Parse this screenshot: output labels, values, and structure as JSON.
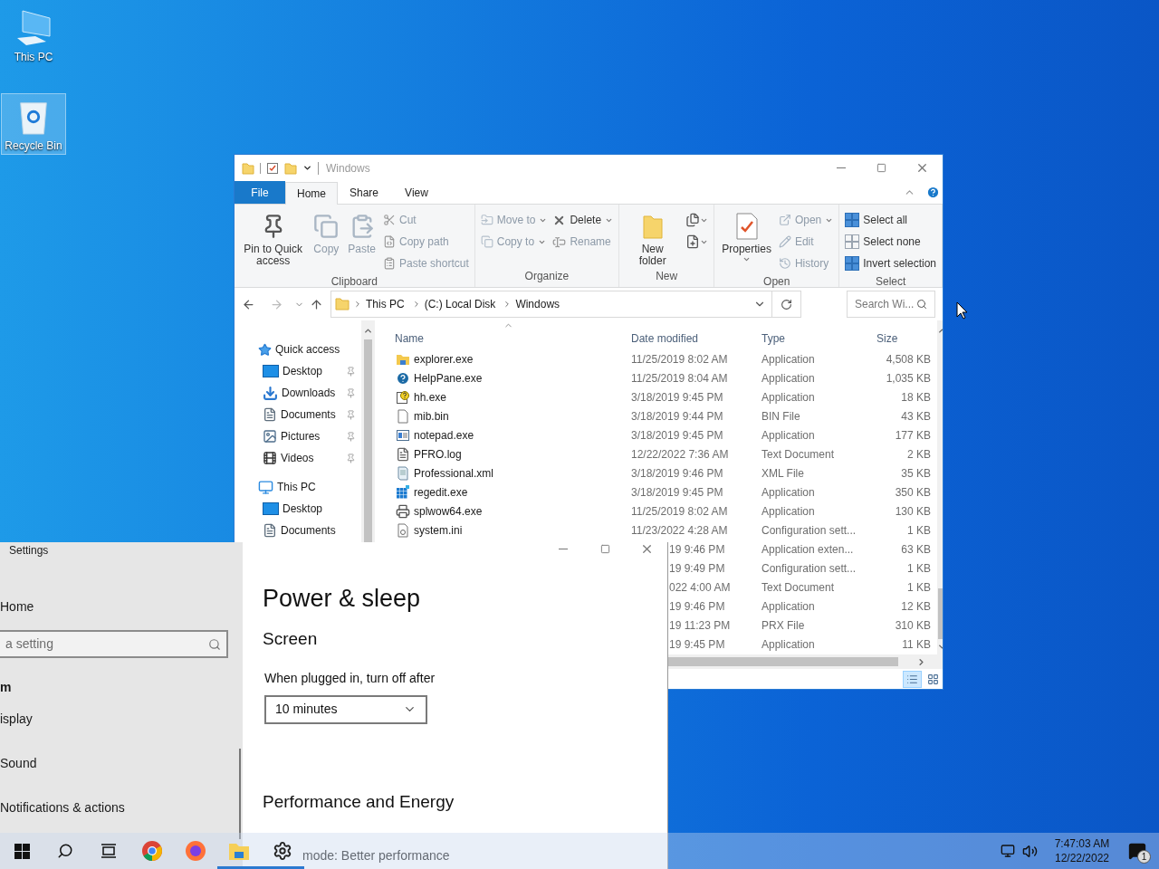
{
  "desktop_icons": [
    {
      "label": "This PC",
      "kind": "computer",
      "selected": false
    },
    {
      "label": "Recycle Bin",
      "kind": "recycle",
      "selected": true
    }
  ],
  "explorer": {
    "title": "Windows",
    "tabs": [
      {
        "label": "File",
        "kind": "file",
        "selected": false
      },
      {
        "label": "Home",
        "kind": "tab",
        "selected": true
      },
      {
        "label": "Share",
        "kind": "tab",
        "selected": false
      },
      {
        "label": "View",
        "kind": "tab",
        "selected": false
      }
    ],
    "ribbon": [
      {
        "label": "Clipboard",
        "columns": [
          [
            {
              "label": "Pin to Quick access",
              "kind": "large",
              "disabled": false,
              "dropdown": false
            }
          ],
          [
            {
              "label": "Copy",
              "kind": "large",
              "disabled": true,
              "dropdown": false
            }
          ],
          [
            {
              "label": "Paste",
              "kind": "large",
              "disabled": true,
              "dropdown": false
            }
          ],
          [
            {
              "label": "Cut",
              "kind": "small",
              "disabled": true,
              "dropdown": false
            },
            {
              "label": "Copy path",
              "kind": "small",
              "disabled": true,
              "dropdown": false
            },
            {
              "label": "Paste shortcut",
              "kind": "small",
              "disabled": true,
              "dropdown": false
            }
          ]
        ]
      },
      {
        "label": "Organize",
        "columns": [
          [
            {
              "label": "Move to",
              "kind": "small",
              "disabled": true,
              "dropdown": true
            },
            {
              "label": "Copy to",
              "kind": "small",
              "disabled": true,
              "dropdown": true
            }
          ],
          [
            {
              "label": "Delete",
              "kind": "small",
              "disabled": false,
              "dropdown": true
            },
            {
              "label": "Rename",
              "kind": "small",
              "disabled": true,
              "dropdown": false
            }
          ]
        ]
      },
      {
        "label": "New",
        "columns": [
          [
            {
              "label": "New folder",
              "kind": "large",
              "disabled": false,
              "dropdown": false
            }
          ],
          [
            {
              "kind": "tool",
              "disabled": false,
              "dropdown": true
            },
            {
              "kind": "tool",
              "disabled": false,
              "dropdown": true
            }
          ]
        ]
      },
      {
        "label": "Open",
        "columns": [
          [
            {
              "label": "Properties",
              "kind": "large",
              "disabled": false,
              "dropdown": true
            }
          ],
          [
            {
              "label": "Open",
              "kind": "small",
              "disabled": true,
              "dropdown": true
            },
            {
              "label": "Edit",
              "kind": "small",
              "disabled": true,
              "dropdown": false
            },
            {
              "label": "History",
              "kind": "small",
              "disabled": true,
              "dropdown": false
            }
          ]
        ]
      },
      {
        "label": "Select",
        "columns": [
          [
            {
              "label": "Select all",
              "kind": "small",
              "disabled": false,
              "dropdown": false
            },
            {
              "label": "Select none",
              "kind": "small",
              "disabled": false,
              "dropdown": false
            },
            {
              "label": "Invert selection",
              "kind": "small",
              "disabled": false,
              "dropdown": false
            }
          ]
        ]
      }
    ],
    "breadcrumb": [
      "This PC",
      "(C:) Local Disk",
      "Windows"
    ],
    "search": {
      "placeholder": "Search Wi..."
    },
    "nav": [
      {
        "label": "Quick access",
        "kind": "star",
        "children": [
          {
            "label": "Desktop",
            "kind": "desktop",
            "pinned": true
          },
          {
            "label": "Downloads",
            "kind": "download",
            "pinned": true
          },
          {
            "label": "Documents",
            "kind": "documents",
            "pinned": true
          },
          {
            "label": "Pictures",
            "kind": "pictures",
            "pinned": true
          },
          {
            "label": "Videos",
            "kind": "videos",
            "pinned": true
          }
        ]
      },
      {
        "label": "This PC",
        "kind": "computer",
        "children": [
          {
            "label": "Desktop",
            "kind": "desktop",
            "pinned": false
          },
          {
            "label": "Documents",
            "kind": "documents",
            "pinned": false
          }
        ]
      }
    ],
    "columns": [
      "Name",
      "Date modified",
      "Type",
      "Size"
    ],
    "rows": [
      {
        "name": "explorer.exe",
        "kind": "explorer",
        "date": "11/25/2019 8:02 AM",
        "type": "Application",
        "size": "4,508 KB"
      },
      {
        "name": "HelpPane.exe",
        "kind": "help",
        "date": "11/25/2019 8:04 AM",
        "type": "Application",
        "size": "1,035 KB"
      },
      {
        "name": "hh.exe",
        "kind": "helpdoc",
        "date": "3/18/2019 9:45 PM",
        "type": "Application",
        "size": "18 KB"
      },
      {
        "name": "mib.bin",
        "kind": "blank",
        "date": "3/18/2019 9:44 PM",
        "type": "BIN File",
        "size": "43 KB"
      },
      {
        "name": "notepad.exe",
        "kind": "notepad",
        "date": "3/18/2019 9:45 PM",
        "type": "Application",
        "size": "177 KB"
      },
      {
        "name": "PFRO.log",
        "kind": "text",
        "date": "12/22/2022 7:36 AM",
        "type": "Text Document",
        "size": "2 KB"
      },
      {
        "name": "Professional.xml",
        "kind": "xml",
        "date": "3/18/2019 9:46 PM",
        "type": "XML File",
        "size": "35 KB"
      },
      {
        "name": "regedit.exe",
        "kind": "registry",
        "date": "3/18/2019 9:45 PM",
        "type": "Application",
        "size": "350 KB"
      },
      {
        "name": "splwow64.exe",
        "kind": "printer",
        "date": "11/25/2019 8:02 AM",
        "type": "Application",
        "size": "130 KB"
      },
      {
        "name": "system.ini",
        "kind": "settings",
        "date": "11/23/2022 4:28 AM",
        "type": "Configuration sett...",
        "size": "1 KB"
      },
      {
        "date": "19 9:46 PM",
        "type": "Application exten...",
        "size": "63 KB"
      },
      {
        "date": "19 9:49 PM",
        "type": "Configuration sett...",
        "size": "1 KB"
      },
      {
        "date": "022 4:00 AM",
        "type": "Text Document",
        "size": "1 KB"
      },
      {
        "date": "19 9:46 PM",
        "type": "Application",
        "size": "12 KB"
      },
      {
        "date": "19 11:23 PM",
        "type": "PRX File",
        "size": "310 KB"
      },
      {
        "date": "19 9:45 PM",
        "type": "Application",
        "size": "11 KB"
      }
    ]
  },
  "settings": {
    "title": "Settings",
    "home": "Home",
    "search": {
      "placeholder": "a setting"
    },
    "section": "m",
    "nav": [
      "isplay",
      "Sound",
      "Notifications & actions"
    ],
    "heading": "Power & sleep",
    "subheading": "Screen",
    "field_label": "When plugged in, turn off after",
    "dropdown": {
      "value": "10 minutes"
    },
    "section_2": "Performance and Energy",
    "power_mode": "mode: Better performance"
  },
  "taskbar": {
    "apps": [
      {
        "kind": "start",
        "active": false
      },
      {
        "kind": "search",
        "active": false
      },
      {
        "kind": "taskview",
        "active": false
      },
      {
        "kind": "chrome",
        "active": false
      },
      {
        "kind": "firefox",
        "active": false
      },
      {
        "kind": "explorer",
        "active": true
      },
      {
        "kind": "settings",
        "active": true
      }
    ],
    "time": "7:47:03 AM",
    "date": "12/22/2022",
    "notifications": "1"
  }
}
